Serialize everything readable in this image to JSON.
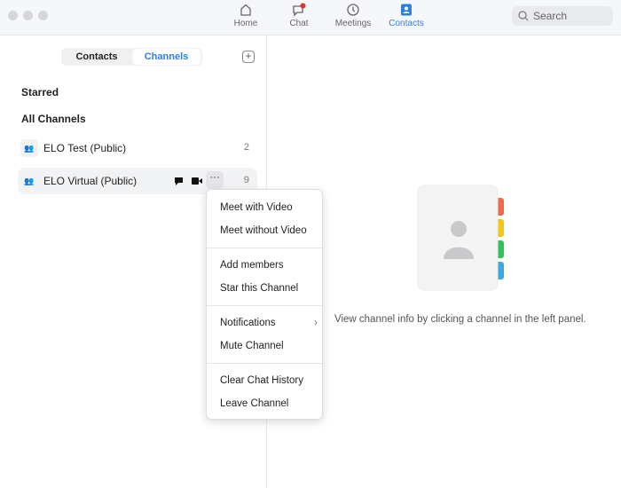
{
  "nav": {
    "items": [
      {
        "label": "Home",
        "icon": "home-icon"
      },
      {
        "label": "Chat",
        "icon": "chat-icon",
        "badge": true
      },
      {
        "label": "Meetings",
        "icon": "clock-icon"
      },
      {
        "label": "Contacts",
        "icon": "contacts-icon",
        "active": true
      }
    ],
    "search_placeholder": "Search"
  },
  "sidebar": {
    "tabs": [
      "Contacts",
      "Channels"
    ],
    "active_tab": "Channels",
    "starred": "Starred",
    "all_channels": "All Channels",
    "channels": [
      {
        "name": "ELO Test (Public)",
        "count": "2"
      },
      {
        "name": "ELO Virtual (Public)",
        "count": "9"
      }
    ]
  },
  "menu": {
    "items": [
      "Meet with Video",
      "Meet without Video",
      "Add members",
      "Star this Channel",
      "Notifications",
      "Mute Channel",
      "Clear Chat History",
      "Leave Channel"
    ]
  },
  "main": {
    "info": "View channel info by clicking a channel in the left panel."
  },
  "colors": {
    "accent": "#2d7fe0",
    "badge": "#e0322b",
    "tabs": [
      "#ee6a4f",
      "#f5c518",
      "#34c05a",
      "#3aa9e0"
    ]
  }
}
